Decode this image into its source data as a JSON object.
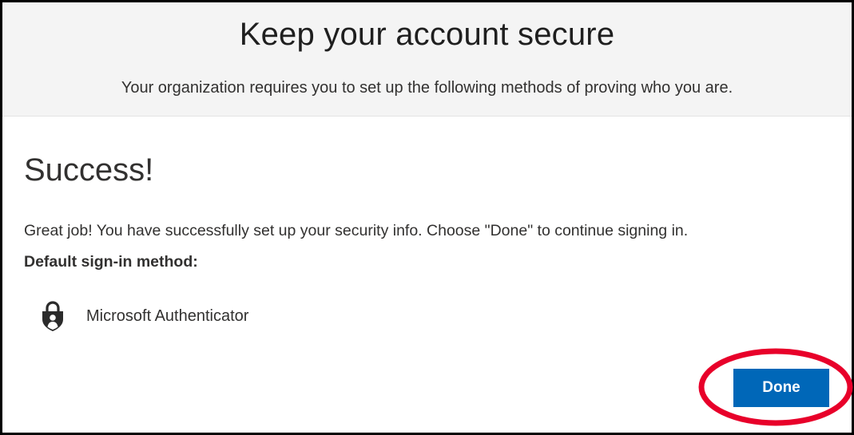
{
  "header": {
    "title": "Keep your account secure",
    "subtitle": "Your organization requires you to set up the following methods of proving who you are."
  },
  "main": {
    "heading": "Success!",
    "message": "Great job! You have successfully set up your security info. Choose \"Done\" to continue signing in.",
    "default_method_label": "Default sign-in method:",
    "method": {
      "icon": "authenticator-lock-icon",
      "label": "Microsoft Authenticator"
    },
    "done_label": "Done"
  },
  "colors": {
    "header_bg": "#f4f4f4",
    "button_bg": "#0067b8",
    "button_text": "#ffffff",
    "highlight_ring": "#e8002a",
    "frame_border": "#000000"
  }
}
